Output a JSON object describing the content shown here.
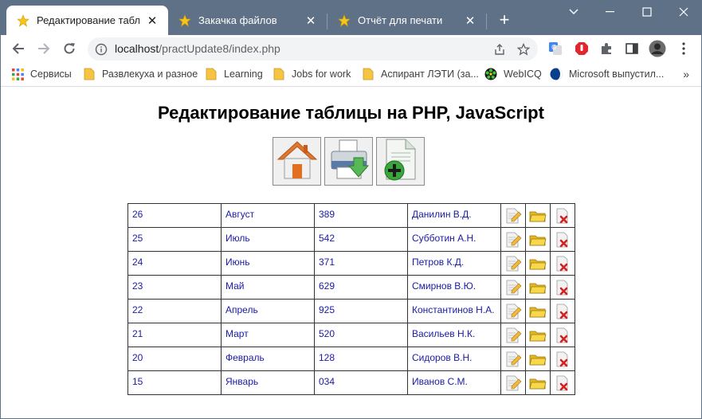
{
  "browser": {
    "tabs": [
      {
        "title": "Редактирование таблицы",
        "active": true
      },
      {
        "title": "Закачка файлов",
        "active": false
      },
      {
        "title": "Отчёт для печати",
        "active": false
      }
    ],
    "close_glyph": "✕",
    "new_tab_glyph": "+",
    "window_controls": {
      "minimize": "—",
      "maximize": "☐",
      "close": "✕",
      "dropdown": "⌄"
    },
    "url": {
      "host": "localhost",
      "path": "/practUpdate8/index.php"
    },
    "bookmarks": [
      {
        "label": "Сервисы",
        "icon": "apps-grid-icon"
      },
      {
        "label": "Развлекуха и разное",
        "icon": "folder-icon"
      },
      {
        "label": "Learning",
        "icon": "folder-icon"
      },
      {
        "label": "Jobs for work",
        "icon": "folder-icon"
      },
      {
        "label": "Аспирант ЛЭТИ (за...",
        "icon": "folder-icon"
      },
      {
        "label": "WebICQ",
        "icon": "icq-icon"
      },
      {
        "label": "Microsoft выпустил...",
        "icon": "globe-icon"
      }
    ],
    "bookmarks_more": "»"
  },
  "page": {
    "title": "Редактирование таблицы на PHP, JavaScript",
    "actions": [
      {
        "name": "home",
        "icon": "home-icon"
      },
      {
        "name": "print",
        "icon": "print-icon"
      },
      {
        "name": "add",
        "icon": "add-document-icon"
      }
    ],
    "table": {
      "rows": [
        {
          "id": "26",
          "month": "Август",
          "value": "389",
          "name": "Данилин В.Д."
        },
        {
          "id": "25",
          "month": "Июль",
          "value": "542",
          "name": "Субботин А.Н."
        },
        {
          "id": "24",
          "month": "Июнь",
          "value": "371",
          "name": "Петров К.Д."
        },
        {
          "id": "23",
          "month": "Май",
          "value": "629",
          "name": "Смирнов В.Ю."
        },
        {
          "id": "22",
          "month": "Апрель",
          "value": "925",
          "name": "Константинов Н.А."
        },
        {
          "id": "21",
          "month": "Март",
          "value": "520",
          "name": "Васильев Н.К."
        },
        {
          "id": "20",
          "month": "Февраль",
          "value": "128",
          "name": "Сидоров В.Н."
        },
        {
          "id": "15",
          "month": "Январь",
          "value": "034",
          "name": "Иванов С.М."
        }
      ],
      "row_actions": [
        "edit-icon",
        "open-folder-icon",
        "delete-icon"
      ]
    }
  },
  "colors": {
    "titlebar": "#5f7186",
    "link_text": "#1a1aa6",
    "folder": "#f6c445"
  }
}
